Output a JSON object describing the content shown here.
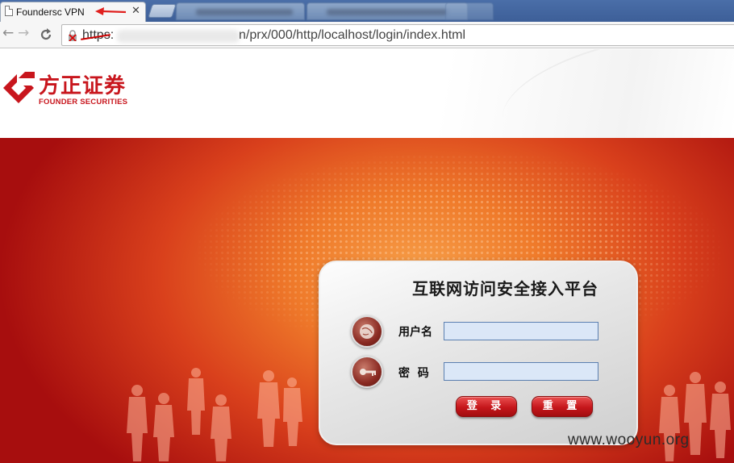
{
  "browser": {
    "active_tab_title": "Foundersc VPN",
    "close_symbol": "✕",
    "url_scheme": "https:",
    "url_path": "n/prx/000/http/localhost/login/index.html"
  },
  "logo": {
    "cn": "方正证券",
    "en": "FOUNDER SECURITIES"
  },
  "login": {
    "title": "互联网访问安全接入平台",
    "username_label": "用户名",
    "username_value": "",
    "password_label": "密  码",
    "password_value": "",
    "login_button": "登 录",
    "reset_button": "重 置"
  },
  "watermark": "www.wooyun.org",
  "colors": {
    "brand_red": "#c8161d",
    "input_bg": "#dbe7f7",
    "input_border": "#5b7fb0"
  }
}
